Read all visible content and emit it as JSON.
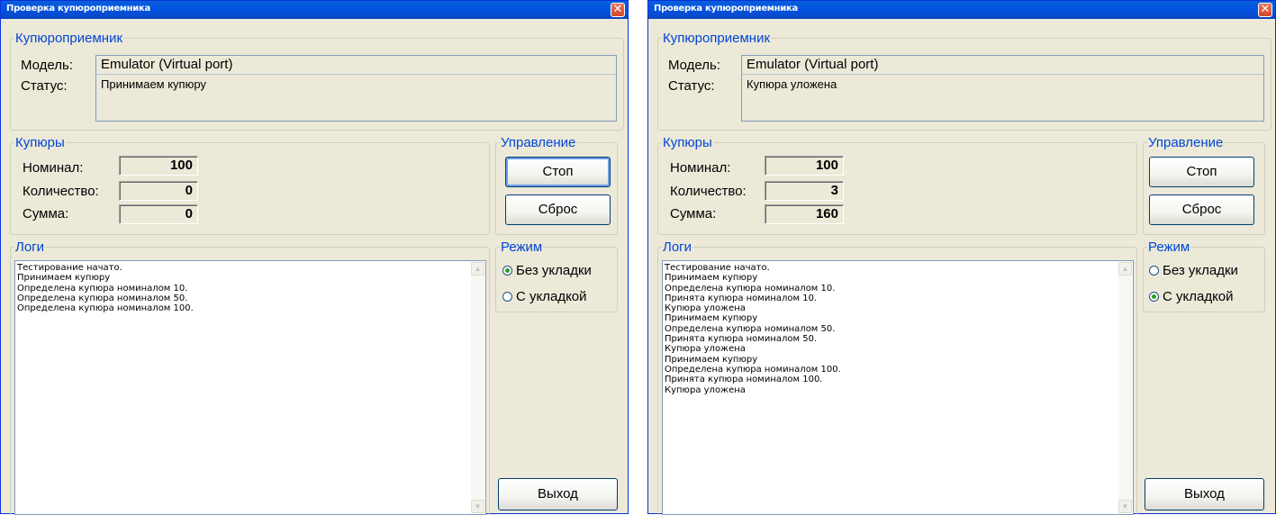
{
  "windows": [
    {
      "title": "Проверка купюроприемника",
      "close_glyph": "✕",
      "acceptor": {
        "legend": "Купюроприемник",
        "model_label": "Модель:",
        "model_value": "Emulator (Virtual port)",
        "status_label": "Статус:",
        "status_value": "Принимаем купюру"
      },
      "bills": {
        "legend": "Купюры",
        "denomination_label": "Номинал:",
        "denomination_value": "100",
        "count_label": "Количество:",
        "count_value": "0",
        "sum_label": "Сумма:",
        "sum_value": "0"
      },
      "control": {
        "legend": "Управление",
        "stop_label": "Стоп",
        "reset_label": "Сброс"
      },
      "logs": {
        "legend": "Логи",
        "lines": [
          "Тестирование начато.",
          "Принимаем купюру",
          "Определена купюра номиналом 10.",
          "Определена купюра номиналом 50.",
          "Определена купюра номиналом 100."
        ]
      },
      "mode": {
        "legend": "Режим",
        "option_no_stack": "Без укладки",
        "option_stack": "С укладкой",
        "selected": "no_stack"
      },
      "exit_label": "Выход"
    },
    {
      "title": "Проверка купюроприемника",
      "close_glyph": "✕",
      "acceptor": {
        "legend": "Купюроприемник",
        "model_label": "Модель:",
        "model_value": "Emulator (Virtual port)",
        "status_label": "Статус:",
        "status_value": "Купюра уложена"
      },
      "bills": {
        "legend": "Купюры",
        "denomination_label": "Номинал:",
        "denomination_value": "100",
        "count_label": "Количество:",
        "count_value": "3",
        "sum_label": "Сумма:",
        "sum_value": "160"
      },
      "control": {
        "legend": "Управление",
        "stop_label": "Стоп",
        "reset_label": "Сброс"
      },
      "logs": {
        "legend": "Логи",
        "lines": [
          "Тестирование начато.",
          "Принимаем купюру",
          "Определена купюра номиналом 10.",
          "Принята купюра номиналом 10.",
          "Купюра уложена",
          "Принимаем купюру",
          "Определена купюра номиналом 50.",
          "Принята купюра номиналом 50.",
          "Купюра уложена",
          "Принимаем купюру",
          "Определена купюра номиналом 100.",
          "Принята купюра номиналом 100.",
          "Купюра уложена"
        ]
      },
      "mode": {
        "legend": "Режим",
        "option_no_stack": "Без укладки",
        "option_stack": "С укладкой",
        "selected": "stack"
      },
      "exit_label": "Выход"
    }
  ],
  "scroll_up_glyph": "▲",
  "scroll_down_glyph": "▼"
}
